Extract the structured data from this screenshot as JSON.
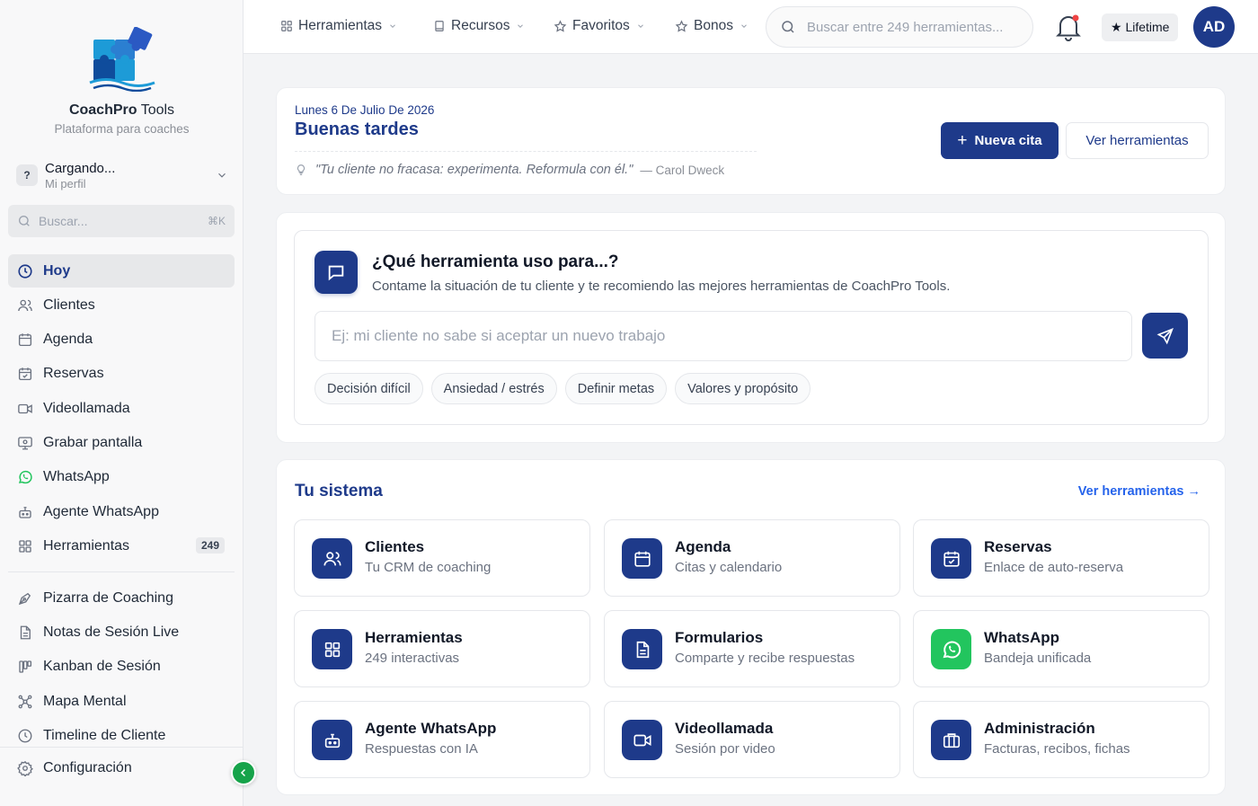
{
  "brand": {
    "name_bold": "CoachPro",
    "name_rest": " Tools",
    "subtitle": "Plataforma para coaches"
  },
  "profile": {
    "initial": "?",
    "name": "Cargando...",
    "sub": "Mi perfil"
  },
  "sidebar_search": {
    "placeholder": "Buscar...",
    "shortcut": "⌘K"
  },
  "sidebar": {
    "items": [
      {
        "label": "Hoy",
        "icon": "clock-icon",
        "active": true
      },
      {
        "label": "Clientes",
        "icon": "users-icon"
      },
      {
        "label": "Agenda",
        "icon": "calendar-icon"
      },
      {
        "label": "Reservas",
        "icon": "calendar-check-icon"
      },
      {
        "label": "Videollamada",
        "icon": "video-icon"
      },
      {
        "label": "Grabar pantalla",
        "icon": "screen-record-icon"
      },
      {
        "label": "WhatsApp",
        "icon": "whatsapp-icon"
      },
      {
        "label": "Agente WhatsApp",
        "icon": "bot-icon"
      },
      {
        "label": "Herramientas",
        "icon": "grid-icon",
        "badge": "249"
      }
    ],
    "items2": [
      {
        "label": "Pizarra de Coaching",
        "icon": "pen-tool-icon"
      },
      {
        "label": "Notas de Sesión Live",
        "icon": "file-text-icon"
      },
      {
        "label": "Kanban de Sesión",
        "icon": "kanban-icon"
      },
      {
        "label": "Mapa Mental",
        "icon": "network-icon"
      },
      {
        "label": "Timeline de Cliente",
        "icon": "clock-icon"
      }
    ],
    "config": "Configuración"
  },
  "topbar": {
    "nav": [
      "Herramientas",
      "Recursos",
      "Favoritos",
      "Bonos"
    ],
    "search_placeholder": "Buscar entre 249 herramientas...",
    "lifetime": "★ Lifetime",
    "avatar": "AD"
  },
  "greeting": {
    "date": "Lunes 6 De Julio De 2026",
    "hello": "Buenas tardes",
    "quote": "\"Tu cliente no fracasa: experimenta. Reformula con él.\"",
    "author": "— Carol Dweck",
    "new_button": "Nueva cita",
    "tools_button": "Ver herramientas"
  },
  "ask": {
    "title": "¿Qué herramienta uso para...?",
    "subtitle": "Contame la situación de tu cliente y te recomiendo las mejores herramientas de CoachPro Tools.",
    "placeholder": "Ej: mi cliente no sabe si aceptar un nuevo trabajo",
    "chips": [
      "Decisión difícil",
      "Ansiedad / estrés",
      "Definir metas",
      "Valores y propósito"
    ]
  },
  "system": {
    "title": "Tu sistema",
    "link": "Ver herramientas →",
    "tiles": [
      {
        "title": "Clientes",
        "sub": "Tu CRM de coaching",
        "icon": "users-icon"
      },
      {
        "title": "Agenda",
        "sub": "Citas y calendario",
        "icon": "calendar-icon"
      },
      {
        "title": "Reservas",
        "sub": "Enlace de auto-reserva",
        "icon": "calendar-check-icon"
      },
      {
        "title": "Herramientas",
        "sub": "249 interactivas",
        "icon": "grid-icon"
      },
      {
        "title": "Formularios",
        "sub": "Comparte y recibe respuestas",
        "icon": "file-text-icon"
      },
      {
        "title": "WhatsApp",
        "sub": "Bandeja unificada",
        "icon": "whatsapp-icon"
      },
      {
        "title": "Agente WhatsApp",
        "sub": "Respuestas con IA",
        "icon": "bot-icon"
      },
      {
        "title": "Videollamada",
        "sub": "Sesión por video",
        "icon": "video-icon"
      },
      {
        "title": "Administración",
        "sub": "Facturas, recibos, fichas",
        "icon": "briefcase-icon"
      }
    ]
  },
  "colors": {
    "primary": "#1e3a8a",
    "whatsapp": "#22c55e",
    "link": "#2563eb"
  }
}
